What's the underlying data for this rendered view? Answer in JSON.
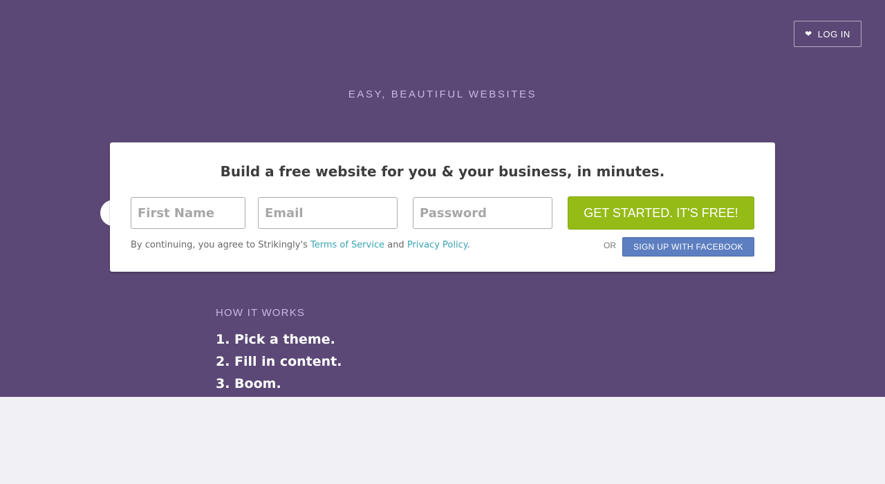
{
  "header": {
    "login_label": "LOG IN",
    "login_icon": "heart-icon"
  },
  "hero": {
    "tagline": "EASY, BEAUTIFUL WEBSITES"
  },
  "signup": {
    "title": "Build a free website for you & your business, in minutes.",
    "first_name": {
      "value": "",
      "placeholder": "First Name"
    },
    "email": {
      "value": "",
      "placeholder": "Email"
    },
    "password": {
      "value": "",
      "placeholder": "Password"
    },
    "cta_label": "GET STARTED. IT'S FREE!",
    "terms_prefix": "By continuing, you agree to Strikingly's ",
    "terms_link": "Terms of Service",
    "terms_and": " and ",
    "privacy_link": "Privacy Policy",
    "terms_suffix": ".",
    "or_label": "OR",
    "facebook_label": "SIGN UP WITH FACEBOOK"
  },
  "how_it_works": {
    "title": "HOW IT WORKS",
    "steps": [
      "1. Pick a theme.",
      "2. Fill in content.",
      "3. Boom."
    ]
  },
  "colors": {
    "hero_bg": "#5b4876",
    "accent_green": "#95bb17",
    "facebook_blue": "#5d7fc1",
    "link": "#3aa4b4"
  }
}
